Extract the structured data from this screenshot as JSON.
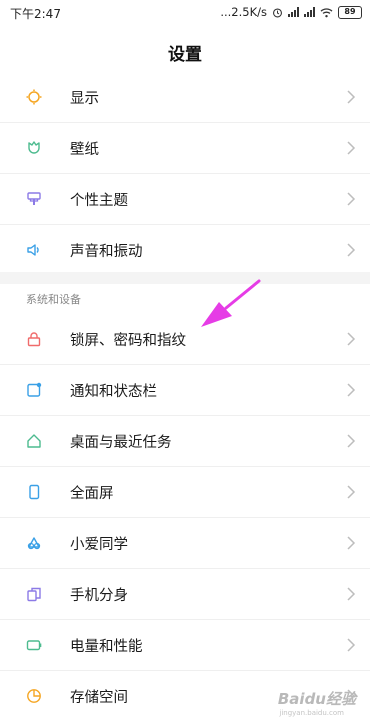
{
  "status_bar": {
    "time": "下午2:47",
    "network_speed": "...2.5K/s",
    "battery": "89"
  },
  "header": {
    "title": "设置"
  },
  "group1": [
    {
      "label": "显示",
      "icon": "sun-icon",
      "color": "#f5a623"
    },
    {
      "label": "壁纸",
      "icon": "tulip-icon",
      "color": "#4dbb8f"
    },
    {
      "label": "个性主题",
      "icon": "brush-icon",
      "color": "#8c7ae6"
    },
    {
      "label": "声音和振动",
      "icon": "speaker-icon",
      "color": "#3aa0e6"
    }
  ],
  "section": {
    "title": "系统和设备"
  },
  "group2": [
    {
      "label": "锁屏、密码和指纹",
      "icon": "lock-icon",
      "color": "#f06b6b"
    },
    {
      "label": "通知和状态栏",
      "icon": "notification-icon",
      "color": "#3aa0e6"
    },
    {
      "label": "桌面与最近任务",
      "icon": "home-icon",
      "color": "#4dbb8f"
    },
    {
      "label": "全面屏",
      "icon": "phone-icon",
      "color": "#3aa0e6"
    },
    {
      "label": "小爱同学",
      "icon": "xiaoai-icon",
      "color": "#3aa0e6"
    },
    {
      "label": "手机分身",
      "icon": "clone-icon",
      "color": "#8c7ae6"
    },
    {
      "label": "电量和性能",
      "icon": "battery-icon",
      "color": "#4dbb8f"
    },
    {
      "label": "存储空间",
      "icon": "pie-icon",
      "color": "#f5a623"
    }
  ],
  "annotation": {
    "color": "#e63ce6"
  },
  "watermark": {
    "text": "Baidu经验",
    "sub": "jingyan.baidu.com"
  }
}
